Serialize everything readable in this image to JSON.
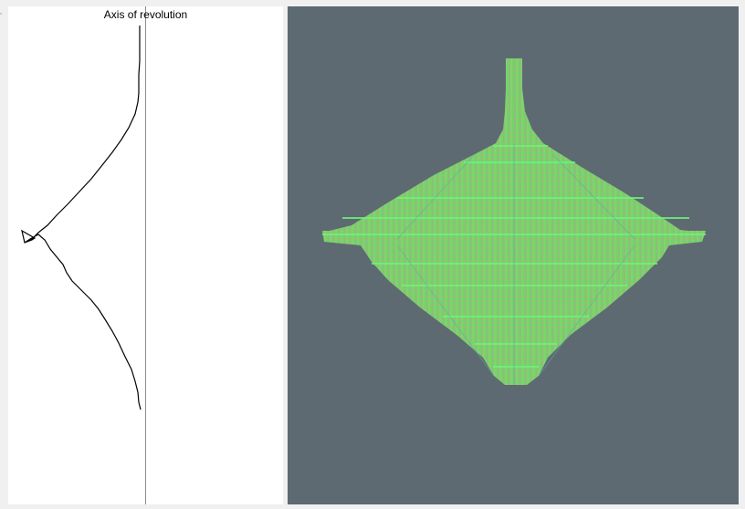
{
  "profile_panel": {
    "axis_label": "Axis of revolution"
  },
  "viewport": {
    "background": "#5d6a72",
    "mesh_colors": [
      "#6fe36f",
      "#8fd06a",
      "#5fa8a8",
      "#c9a45e",
      "#b5c96a",
      "#4ee07a"
    ]
  }
}
